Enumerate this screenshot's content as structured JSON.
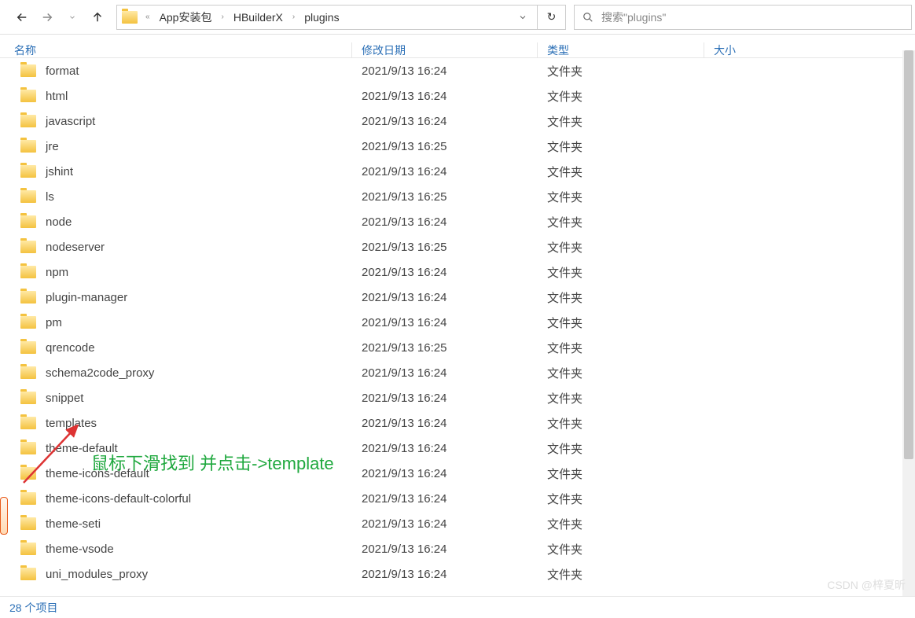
{
  "nav": {
    "back_enabled": true,
    "forward_enabled": false,
    "up_enabled": true
  },
  "breadcrumb": {
    "overflow": "«",
    "items": [
      "App安装包",
      "HBuilderX",
      "plugins"
    ]
  },
  "refresh_glyph": "↻",
  "search": {
    "placeholder": "搜索\"plugins\""
  },
  "columns": {
    "name": "名称",
    "date": "修改日期",
    "type": "类型",
    "size": "大小"
  },
  "type_folder": "文件夹",
  "rows": [
    {
      "name": "format",
      "date": "2021/9/13 16:24"
    },
    {
      "name": "html",
      "date": "2021/9/13 16:24"
    },
    {
      "name": "javascript",
      "date": "2021/9/13 16:24"
    },
    {
      "name": "jre",
      "date": "2021/9/13 16:25"
    },
    {
      "name": "jshint",
      "date": "2021/9/13 16:24"
    },
    {
      "name": "ls",
      "date": "2021/9/13 16:25"
    },
    {
      "name": "node",
      "date": "2021/9/13 16:24"
    },
    {
      "name": "nodeserver",
      "date": "2021/9/13 16:25"
    },
    {
      "name": "npm",
      "date": "2021/9/13 16:24"
    },
    {
      "name": "plugin-manager",
      "date": "2021/9/13 16:24"
    },
    {
      "name": "pm",
      "date": "2021/9/13 16:24"
    },
    {
      "name": "qrencode",
      "date": "2021/9/13 16:25"
    },
    {
      "name": "schema2code_proxy",
      "date": "2021/9/13 16:24"
    },
    {
      "name": "snippet",
      "date": "2021/9/13 16:24"
    },
    {
      "name": "templates",
      "date": "2021/9/13 16:24"
    },
    {
      "name": "theme-default",
      "date": "2021/9/13 16:24"
    },
    {
      "name": "theme-icons-default",
      "date": "2021/9/13 16:24"
    },
    {
      "name": "theme-icons-default-colorful",
      "date": "2021/9/13 16:24"
    },
    {
      "name": "theme-seti",
      "date": "2021/9/13 16:24"
    },
    {
      "name": "theme-vsode",
      "date": "2021/9/13 16:24"
    },
    {
      "name": "uni_modules_proxy",
      "date": "2021/9/13 16:24"
    }
  ],
  "status": "28 个项目",
  "annotation_text": "鼠标下滑找到 并点击->template",
  "watermark": "CSDN @梓夏昕"
}
